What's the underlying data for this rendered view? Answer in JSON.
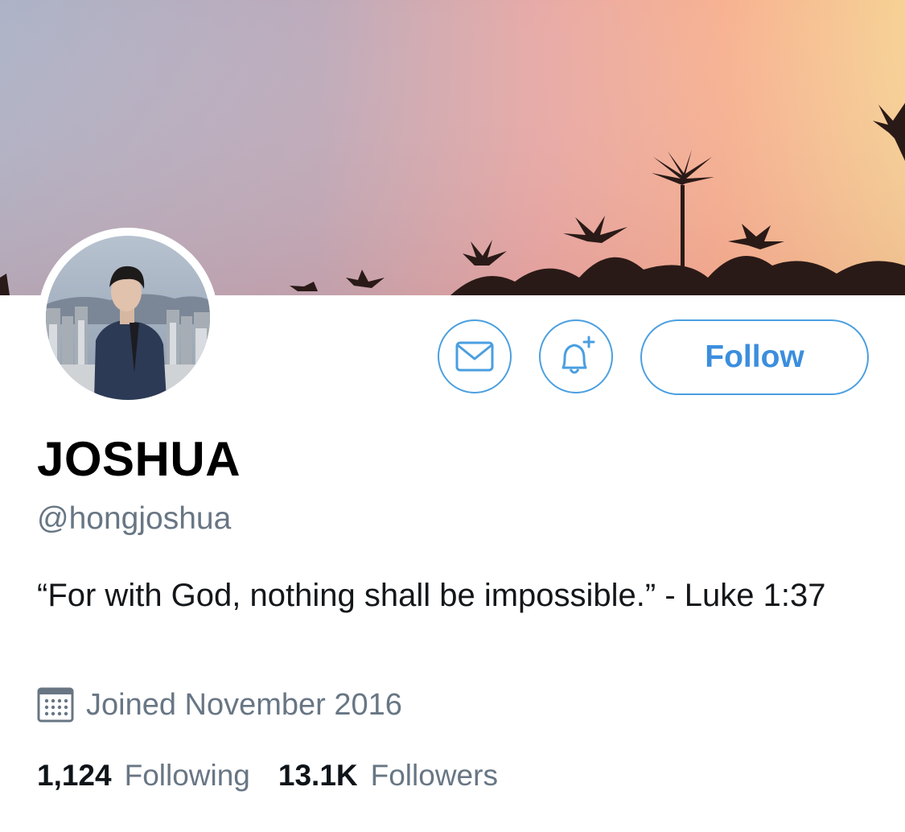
{
  "profile": {
    "display_name": "JOSHUA",
    "handle": "@hongjoshua",
    "bio": "“For with God, nothing shall be impossible.” - Luke 1:37",
    "joined": "Joined November 2016"
  },
  "actions": {
    "message_icon": "envelope-icon",
    "notify_icon": "bell-plus-icon",
    "follow_label": "Follow"
  },
  "stats": {
    "following_count": "1,124",
    "following_label": "Following",
    "followers_count": "13.1K",
    "followers_label": "Followers"
  },
  "colors": {
    "accent": "#4a9fe0",
    "secondary_text": "#687684"
  }
}
